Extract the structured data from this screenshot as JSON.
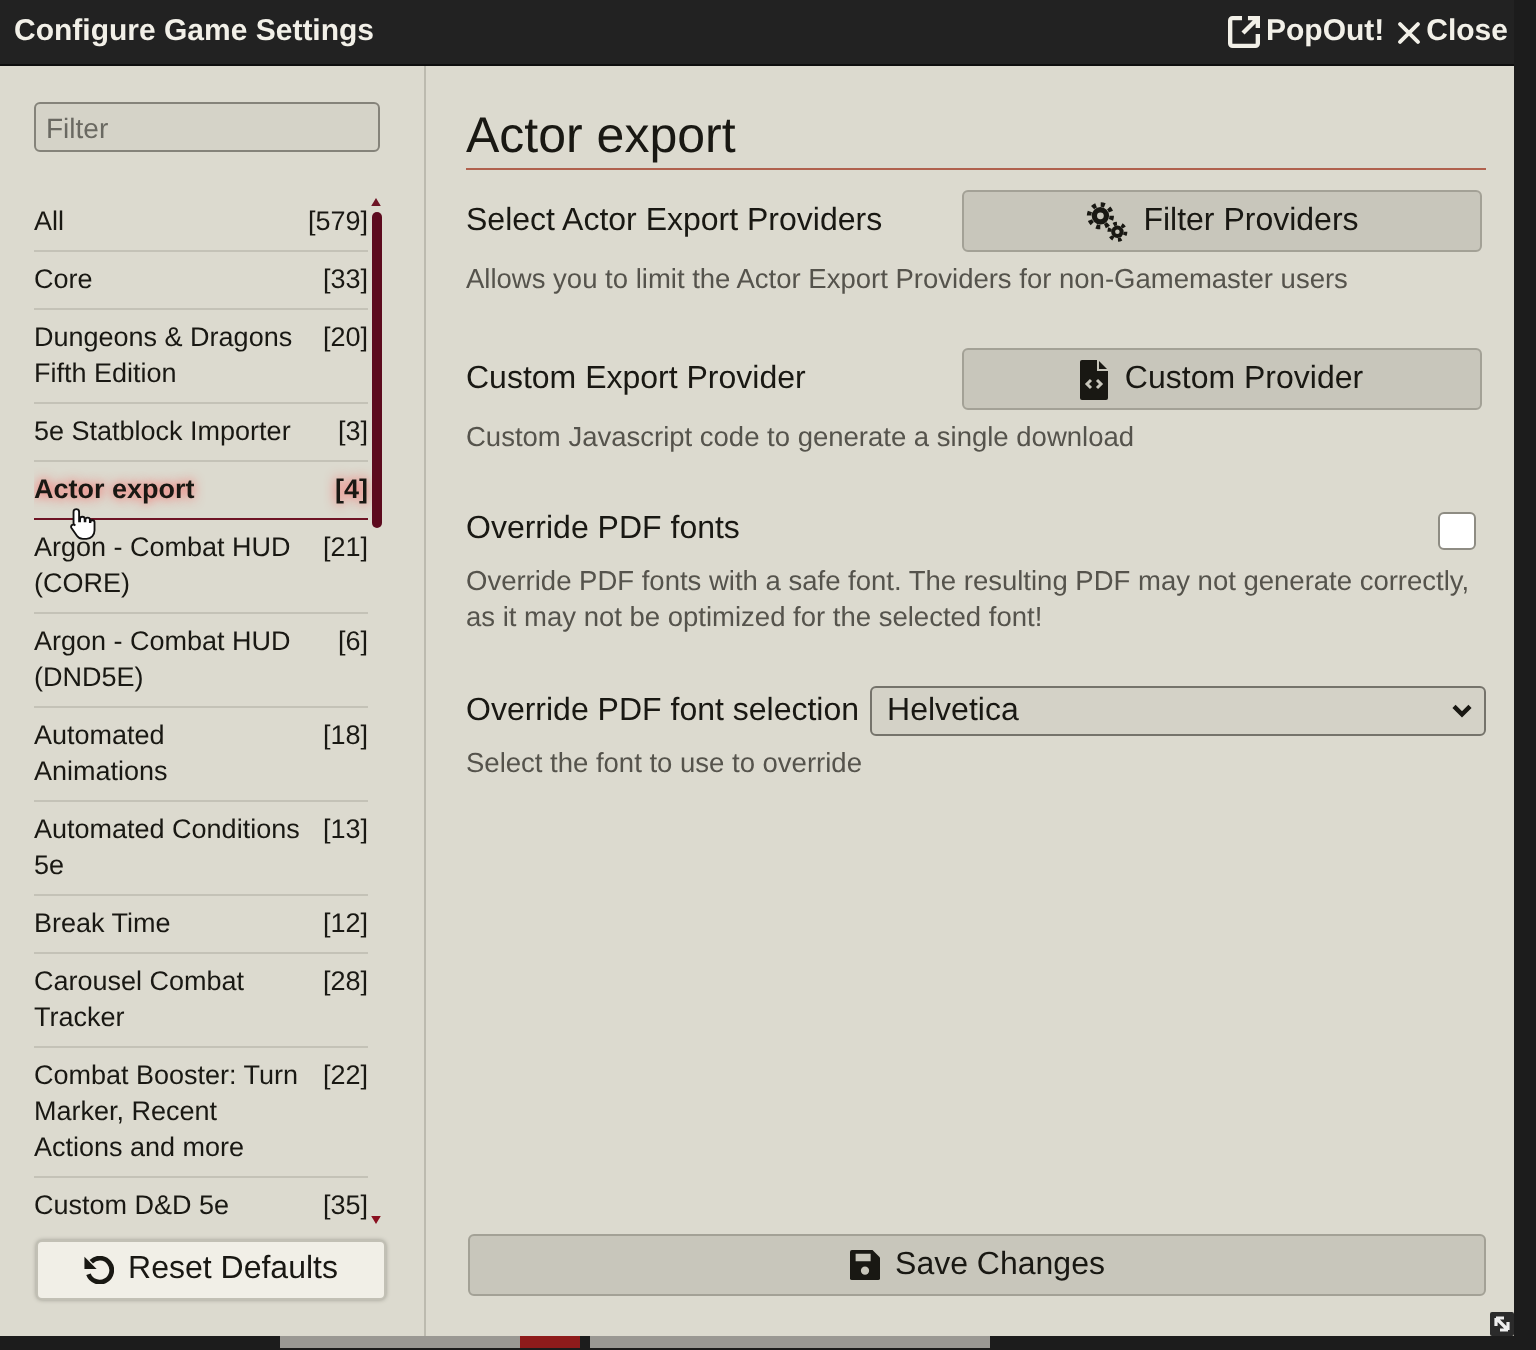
{
  "window": {
    "title": "Configure Game Settings",
    "header_buttons": [
      {
        "kind": "popout",
        "label": "PopOut!"
      },
      {
        "kind": "close",
        "label": "Close"
      }
    ]
  },
  "sidebar": {
    "filter": {
      "placeholder": "Filter"
    },
    "items": [
      {
        "label": "All",
        "count": "[579]",
        "selected": false
      },
      {
        "label": "Core",
        "count": "[33]",
        "selected": false
      },
      {
        "label": "Dungeons & Dragons Fifth Edition",
        "count": "[20]",
        "selected": false
      },
      {
        "label": "5e Statblock Importer",
        "count": "[3]",
        "selected": false
      },
      {
        "label": "Actor export",
        "count": "[4]",
        "selected": true
      },
      {
        "label": "Argon - Combat HUD (CORE)",
        "count": "[21]",
        "selected": false
      },
      {
        "label": "Argon - Combat HUD (DND5E)",
        "count": "[6]",
        "selected": false
      },
      {
        "label": "Automated Animations",
        "count": "[18]",
        "selected": false
      },
      {
        "label": "Automated Conditions 5e",
        "count": "[13]",
        "selected": false
      },
      {
        "label": "Break Time",
        "count": "[12]",
        "selected": false
      },
      {
        "label": "Carousel Combat Tracker",
        "count": "[28]",
        "selected": false
      },
      {
        "label": "Combat Booster: Turn Marker, Recent Actions and more",
        "count": "[22]",
        "selected": false
      },
      {
        "label": "Custom D&D 5e",
        "count": "[35]",
        "selected": false
      }
    ],
    "reset_button": {
      "label": "Reset Defaults"
    }
  },
  "main": {
    "heading": "Actor export",
    "settings": [
      {
        "kind": "menu",
        "label": "Select Actor Export Providers",
        "button": "Filter Providers",
        "hint": "Allows you to limit the Actor Export Providers for non-Gamemaster users"
      },
      {
        "kind": "menu",
        "label": "Custom Export Provider",
        "button": "Custom Provider",
        "hint": "Custom Javascript code to generate a single download"
      },
      {
        "kind": "checkbox",
        "label": "Override PDF fonts",
        "checked": false,
        "hint": "Override PDF fonts with a safe font. The resulting PDF may not generate correctly, as it may not be optimized for the selected font!"
      },
      {
        "kind": "select",
        "label": "Override PDF font selection",
        "value": "Helvetica",
        "hint": "Select the font to use to override"
      }
    ],
    "save_button": {
      "label": "Save Changes"
    }
  }
}
